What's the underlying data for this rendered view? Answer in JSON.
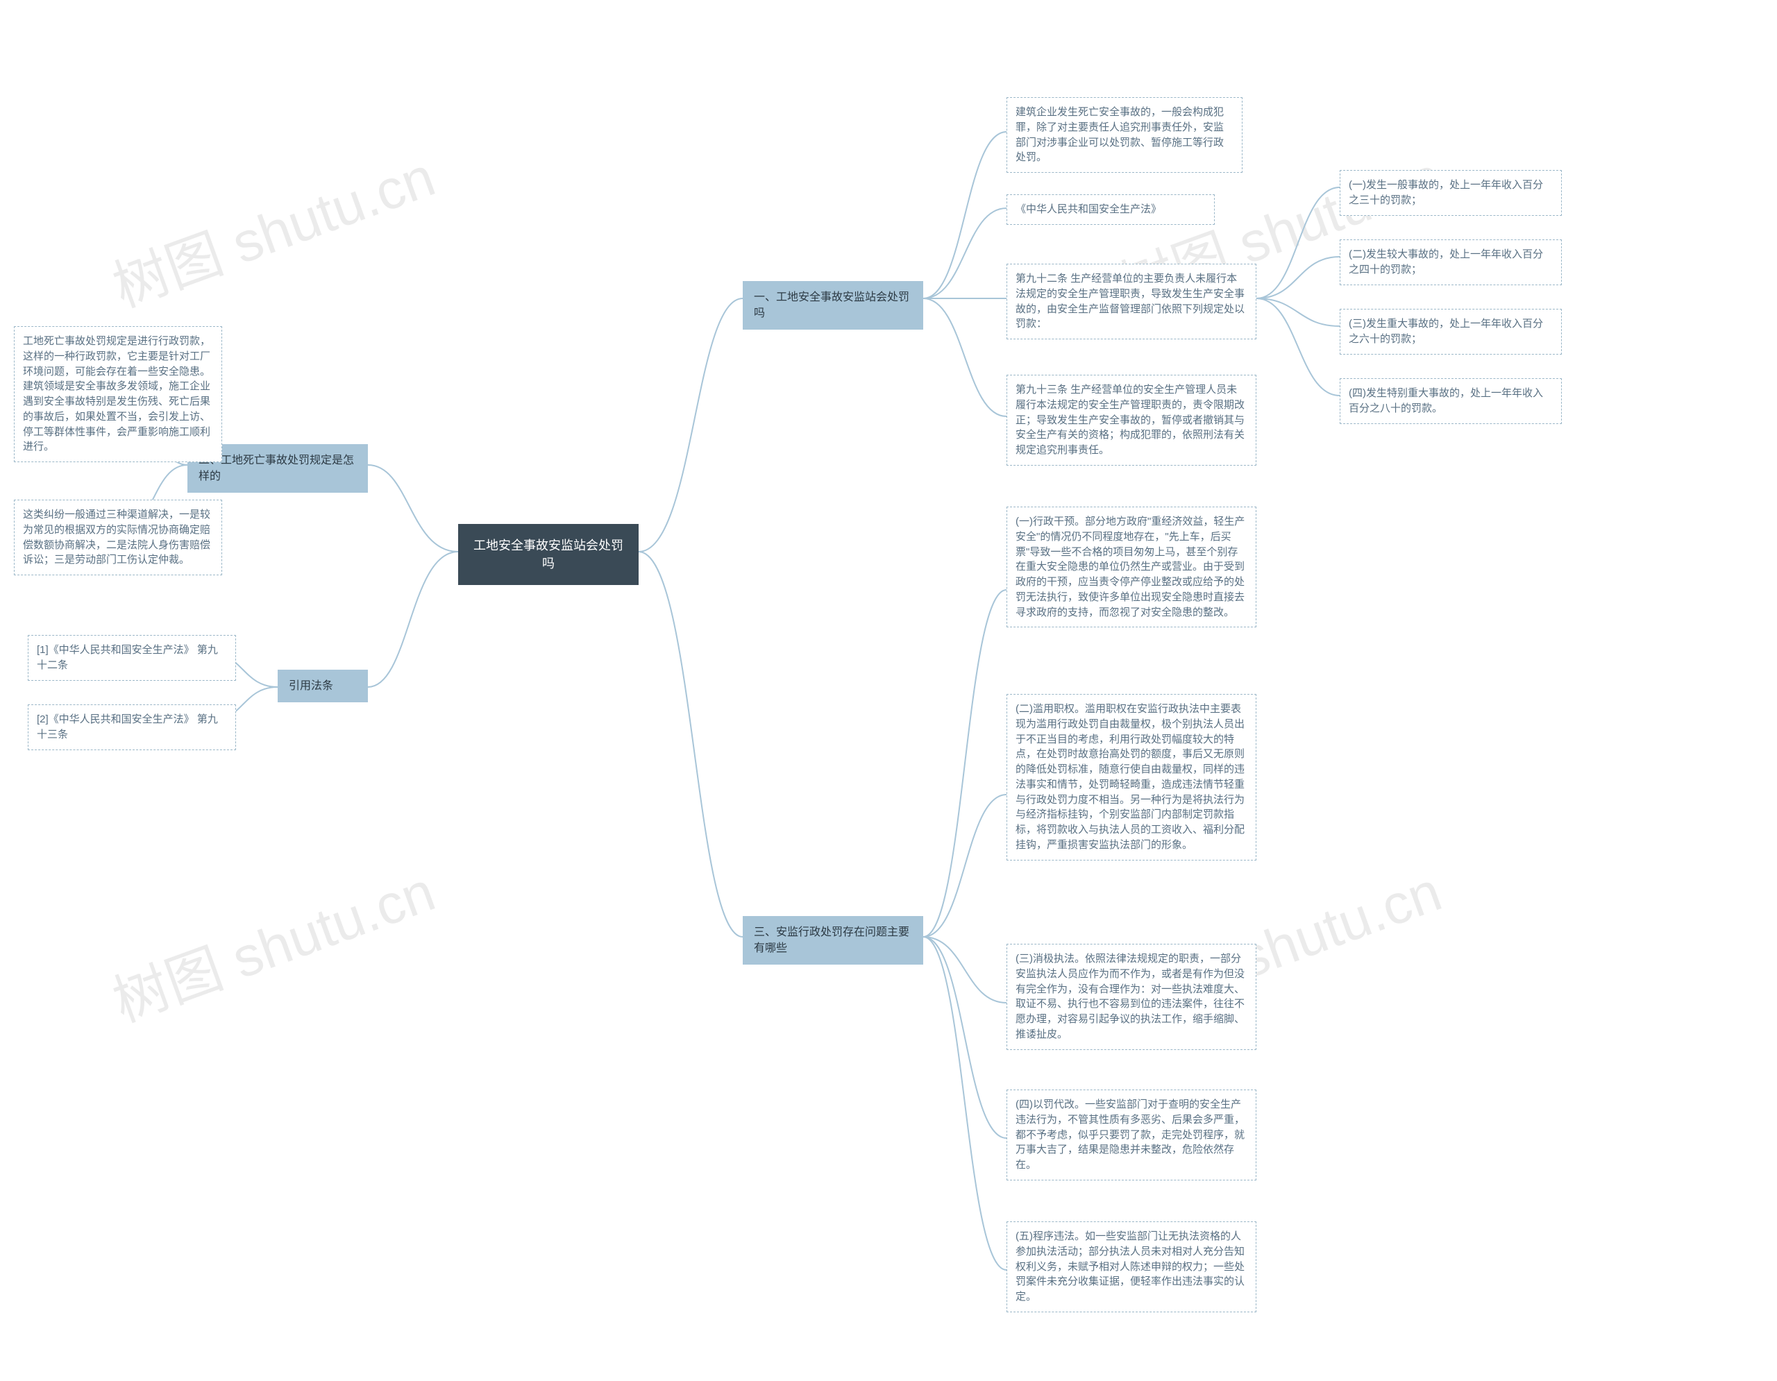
{
  "watermark": "树图 shutu.cn",
  "root": {
    "title": "工地安全事故安监站会处罚吗"
  },
  "right": {
    "s1": {
      "title": "一、工地安全事故安监站会处罚吗",
      "n1": "建筑企业发生死亡安全事故的，一般会构成犯罪，除了对主要责任人追究刑事责任外，安监部门对涉事企业可以处罚款、暂停施工等行政处罚。",
      "n2": "《中华人民共和国安全生产法》",
      "n3": "第九十二条 生产经营单位的主要负责人未履行本法规定的安全生产管理职责，导致发生生产安全事故的，由安全生产监督管理部门依照下列规定处以罚款：",
      "n3a": "(一)发生一般事故的，处上一年年收入百分之三十的罚款；",
      "n3b": "(二)发生较大事故的，处上一年年收入百分之四十的罚款；",
      "n3c": "(三)发生重大事故的，处上一年年收入百分之六十的罚款；",
      "n3d": "(四)发生特别重大事故的，处上一年年收入百分之八十的罚款。",
      "n4": "第九十三条 生产经营单位的安全生产管理人员未履行本法规定的安全生产管理职责的，责令限期改正；导致发生生产安全事故的，暂停或者撤销其与安全生产有关的资格；构成犯罪的，依照刑法有关规定追究刑事责任。"
    },
    "s3": {
      "title": "三、安监行政处罚存在问题主要有哪些",
      "n1": "(一)行政干预。部分地方政府\"重经济效益，轻生产安全\"的情况仍不同程度地存在，\"先上车，后买票\"导致一些不合格的项目匆匆上马，甚至个别存在重大安全隐患的单位仍然生产或营业。由于受到政府的干预，应当责令停产停业整改或应给予的处罚无法执行，致使许多单位出现安全隐患时直接去寻求政府的支持，而忽视了对安全隐患的整改。",
      "n2": "(二)滥用职权。滥用职权在安监行政执法中主要表现为滥用行政处罚自由裁量权，极个别执法人员出于不正当目的考虑，利用行政处罚幅度较大的特点，在处罚时故意抬高处罚的额度，事后又无原则的降低处罚标准，随意行使自由裁量权，同样的违法事实和情节，处罚畸轻畸重，造成违法情节轻重与行政处罚力度不相当。另一种行为是将执法行为与经济指标挂钩，个别安监部门内部制定罚款指标，将罚款收入与执法人员的工资收入、福利分配挂钩，严重损害安监执法部门的形象。",
      "n3": "(三)消极执法。依照法律法规规定的职责，一部分安监执法人员应作为而不作为，或者是有作为但没有完全作为，没有合理作为：对一些执法难度大、取证不易、执行也不容易到位的违法案件，往往不愿办理，对容易引起争议的执法工作，缩手缩脚、推诿扯皮。",
      "n4": "(四)以罚代改。一些安监部门对于查明的安全生产违法行为，不管其性质有多恶劣、后果会多严重，都不予考虑，似乎只要罚了款，走完处罚程序，就万事大吉了，结果是隐患并未整改，危险依然存在。",
      "n5": "(五)程序违法。如一些安监部门让无执法资格的人参加执法活动；部分执法人员未对相对人充分告知权利义务，未赋予相对人陈述申辩的权力；一些处罚案件未充分收集证据，便轻率作出违法事实的认定。"
    }
  },
  "left": {
    "s2": {
      "title": "二、工地死亡事故处罚规定是怎样的",
      "n1": "工地死亡事故处罚规定是进行行政罚款，这样的一种行政罚款，它主要是针对工厂环境问题，可能会存在着一些安全隐患。建筑领域是安全事故多发领域，施工企业遇到安全事故特别是发生伤残、死亡后果的事故后，如果处置不当，会引发上访、停工等群体性事件，会严重影响施工顺利进行。",
      "n2": "这类纠纷一般通过三种渠道解决，一是较为常见的根据双方的实际情况协商确定赔偿数额协商解决，二是法院人身伤害赔偿诉讼；三是劳动部门工伤认定仲裁。"
    },
    "ref": {
      "title": "引用法条",
      "n1": "[1]《中华人民共和国安全生产法》 第九十二条",
      "n2": "[2]《中华人民共和国安全生产法》 第九十三条"
    }
  },
  "colors": {
    "root": "#3a4a56",
    "branch": "#a8c5d8",
    "leafBorder": "#9bb7c8",
    "connector": "#a8c5d8"
  }
}
